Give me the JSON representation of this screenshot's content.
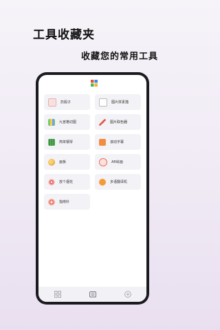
{
  "promo": {
    "headline": "工具收藏夹",
    "subline": "收藏您的常用工具"
  },
  "tools": [
    {
      "label": "扔骰子",
      "icon": "dice-icon",
      "color": "#f0b8b8"
    },
    {
      "label": "图片拼素描",
      "icon": "sketch-icon",
      "color": "#d7d7d7"
    },
    {
      "label": "九宫格切图",
      "icon": "grid-icon",
      "color": "#7ac96f"
    },
    {
      "label": "图片取色器",
      "icon": "eyedropper-icon",
      "color": "#e0584b"
    },
    {
      "label": "简单钢琴",
      "icon": "piano-icon",
      "color": "#5bb55c"
    },
    {
      "label": "滚动字幕",
      "icon": "marquee-icon",
      "color": "#f18c43"
    },
    {
      "label": "画板",
      "icon": "palette-icon",
      "color": "#e8a447"
    },
    {
      "label": "AR绘画",
      "icon": "ar-paint-icon",
      "color": "#e86f5a"
    },
    {
      "label": "放个烟花",
      "icon": "fireworks-icon",
      "color": "#e2544f"
    },
    {
      "label": "多语翻译机",
      "icon": "translator-icon",
      "color": "#f29b38"
    },
    {
      "label": "指南针",
      "icon": "compass-icon",
      "color": "#e8674f"
    }
  ],
  "tabs": [
    {
      "name": "tools-tab-icon",
      "active": false
    },
    {
      "name": "favorites-tab-icon",
      "active": true
    },
    {
      "name": "add-tab-icon",
      "active": false
    }
  ]
}
